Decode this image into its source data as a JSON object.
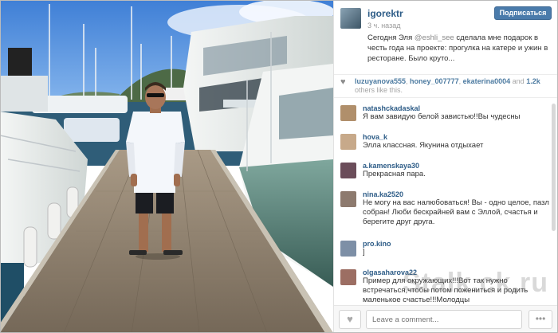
{
  "post": {
    "username": "igorektr",
    "time": "3 ч. назад",
    "follow_label": "Подписаться",
    "caption_part1": "Сегодня Эля ",
    "caption_mention": "@eshli_see",
    "caption_part2": " сделала мне подарок в честь года на проекте: прогулка на катере и ужин в ресторане. Было круто..."
  },
  "likes": {
    "users": [
      "luzuyanova555",
      "honey_007777",
      "ekaterina0004"
    ],
    "and": "and",
    "count": "1.2k",
    "suffix": "others like this."
  },
  "comments": [
    {
      "user": "natashckadaskal",
      "text": "Я вам завидую белой завистью!!Вы чудесны",
      "avatar_color": "#b08f6b"
    },
    {
      "user": "hova_k",
      "text": "Элла классная. Якунина отдыхает",
      "avatar_color": "#c7a98a"
    },
    {
      "user": "a.kamenskaya30",
      "text": "Прекрасная пара.",
      "avatar_color": "#6b4d5a"
    },
    {
      "user": "nina.ka2520",
      "text": "Не могу на вас налюбоваться! Вы - одно целое, пазл собран! Люби бескрайней вам с Эллой, счастья и берегите друг друга.",
      "avatar_color": "#8d7a6e"
    },
    {
      "user": "pro.kino",
      "text": "]",
      "avatar_color": "#7d8fa6"
    },
    {
      "user": "olgasaharova22",
      "text": "Пример для окружающих!!!Вот так нужно встречаться,чтобы потом пожениться и родить маленькое счастье!!!Молодцы",
      "avatar_color": "#9c6e63"
    }
  ],
  "footer": {
    "like_icon": "heart-icon",
    "comment_placeholder": "Leave a comment...",
    "more_label": "•••"
  },
  "watermark": "Stalk.ck.ru"
}
